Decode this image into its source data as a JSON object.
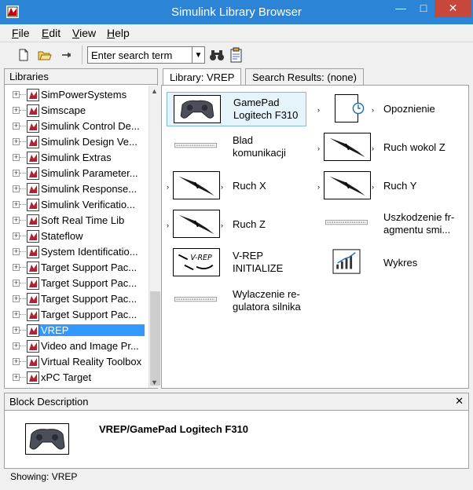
{
  "window": {
    "title": "Simulink Library Browser"
  },
  "menu": {
    "file": "File",
    "edit": "Edit",
    "view": "View",
    "help": "Help"
  },
  "toolbar": {
    "search_value": "Enter search term"
  },
  "libraries": {
    "header": "Libraries",
    "items": [
      {
        "label": "SimPowerSystems"
      },
      {
        "label": "Simscape"
      },
      {
        "label": "Simulink Control De..."
      },
      {
        "label": "Simulink Design Ve..."
      },
      {
        "label": "Simulink Extras"
      },
      {
        "label": "Simulink Parameter..."
      },
      {
        "label": "Simulink Response..."
      },
      {
        "label": "Simulink Verificatio..."
      },
      {
        "label": "Soft Real Time Lib"
      },
      {
        "label": "Stateflow"
      },
      {
        "label": "System Identificatio..."
      },
      {
        "label": "Target Support Pac..."
      },
      {
        "label": "Target Support Pac..."
      },
      {
        "label": "Target Support Pac..."
      },
      {
        "label": "Target Support Pac..."
      },
      {
        "label": "VREP",
        "selected": true
      },
      {
        "label": "Video and Image Pr..."
      },
      {
        "label": "Virtual Reality Toolbox"
      },
      {
        "label": "xPC Target"
      }
    ]
  },
  "tabs": {
    "library": "Library: VREP",
    "search": "Search Results: (none)"
  },
  "blocks": [
    {
      "label": "GamePad\nLogitech F310"
    },
    {
      "label": "Opoznienie"
    },
    {
      "label": "Blad\nkomunikacji"
    },
    {
      "label": "Ruch wokol Z"
    },
    {
      "label": "Ruch X"
    },
    {
      "label": "Ruch Y"
    },
    {
      "label": "Ruch Z"
    },
    {
      "label": "Uszkodzenie fr-\nagmentu smi..."
    },
    {
      "label": "V-REP\nINITIALIZE"
    },
    {
      "label": "Wykres"
    },
    {
      "label": "Wylaczenie re-\ngulatora silnika"
    }
  ],
  "description": {
    "header": "Block Description",
    "title": "VREP/GamePad Logitech F310"
  },
  "status": {
    "text": "Showing: VREP"
  }
}
